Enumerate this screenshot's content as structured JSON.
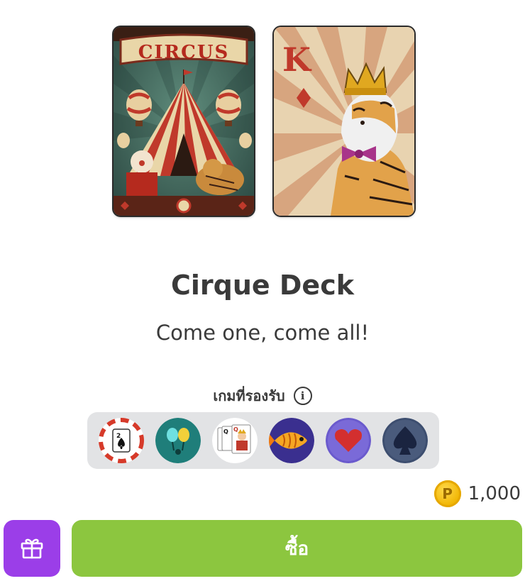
{
  "deck": {
    "title": "Cirque Deck",
    "subtitle": "Come one, come all!",
    "back_banner_text": "CIRCUS",
    "face_card_rank": "K"
  },
  "supported_games": {
    "label": "เกมที่รองรับ",
    "info_icon": "info-icon",
    "games": [
      {
        "icon": "blackjack-chip-icon"
      },
      {
        "icon": "balloons-icon"
      },
      {
        "icon": "queen-cards-icon"
      },
      {
        "icon": "fish-icon"
      },
      {
        "icon": "heart-icon"
      },
      {
        "icon": "spade-icon"
      }
    ]
  },
  "price": {
    "currency_icon": "coin-icon",
    "currency_symbol": "P",
    "amount": "1,000"
  },
  "actions": {
    "gift_icon": "gift-icon",
    "buy_label": "ซื้อ"
  },
  "colors": {
    "buy_button": "#8cc63f",
    "gift_button": "#9b3ee8",
    "games_strip": "#e2e3e5",
    "text": "#3a3a3a"
  }
}
